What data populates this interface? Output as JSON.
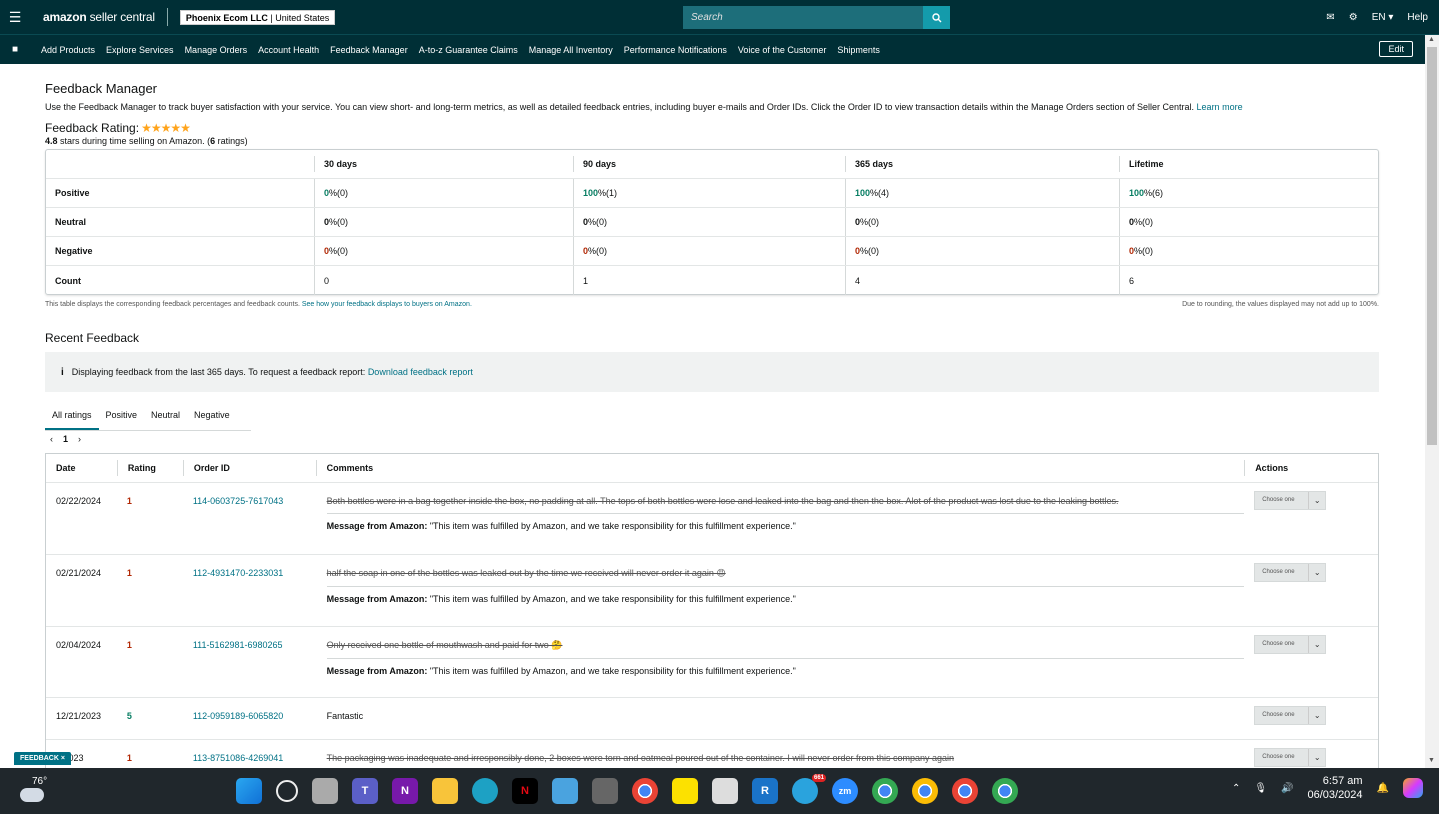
{
  "topbar": {
    "logo_main": "amazon",
    "logo_sub": "seller central",
    "account_name": "Phoenix Ecom LLC",
    "account_country": "United States",
    "search_placeholder": "Search",
    "language": "EN",
    "help": "Help"
  },
  "nav": {
    "items": [
      "Add Products",
      "Explore Services",
      "Manage Orders",
      "Account Health",
      "Feedback Manager",
      "A-to-z Guarantee Claims",
      "Manage All Inventory",
      "Performance Notifications",
      "Voice of the Customer",
      "Shipments"
    ],
    "edit": "Edit"
  },
  "page": {
    "title": "Feedback Manager",
    "intro": "Use the Feedback Manager to track buyer satisfaction with your service. You can view short- and long-term metrics, as well as detailed feedback entries, including buyer e-mails and Order IDs. Click the Order ID to view transaction details within the Manage Orders section of Seller Central.",
    "learn_more": "Learn more",
    "rating_title": "Feedback Rating:",
    "stars": "★★★★★",
    "rating_value": "4.8",
    "rating_text1": "stars during time selling on Amazon. (",
    "rating_count": "6",
    "rating_text2": "ratings)"
  },
  "metrics": {
    "headers": [
      "30 days",
      "90 days",
      "365 days",
      "Lifetime"
    ],
    "rows": [
      {
        "label": "Positive",
        "cells": [
          {
            "v": "0",
            "r": " %(0)"
          },
          {
            "v": "100",
            "r": " %(1)"
          },
          {
            "v": "100",
            "r": " %(4)"
          },
          {
            "v": "100",
            "r": " %(6)"
          }
        ]
      },
      {
        "label": "Neutral",
        "cells": [
          {
            "v": "0",
            "r": " %(0)"
          },
          {
            "v": "0",
            "r": " %(0)"
          },
          {
            "v": "0",
            "r": " %(0)"
          },
          {
            "v": "0",
            "r": " %(0)"
          }
        ]
      },
      {
        "label": "Negative",
        "cells": [
          {
            "v": "0",
            "r": " %(0)"
          },
          {
            "v": "0",
            "r": " %(0)"
          },
          {
            "v": "0",
            "r": " %(0)"
          },
          {
            "v": "0",
            "r": " %(0)"
          }
        ]
      },
      {
        "label": "Count",
        "cells": [
          {
            "v": "",
            "r": "0"
          },
          {
            "v": "",
            "r": "1"
          },
          {
            "v": "",
            "r": "4"
          },
          {
            "v": "",
            "r": "6"
          }
        ]
      }
    ],
    "foot_left": "This table displays the corresponding feedback percentages and feedback counts.",
    "foot_link": "See how your feedback displays to buyers on Amazon.",
    "foot_right": "Due to rounding, the values displayed may not add up to 100%."
  },
  "recent": {
    "title": "Recent Feedback",
    "info_text": "Displaying feedback from the last 365 days. To request a feedback report:",
    "info_link": "Download feedback report",
    "tabs": [
      "All ratings",
      "Positive",
      "Neutral",
      "Negative"
    ],
    "page": "1",
    "headers": [
      "Date",
      "Rating",
      "Order ID",
      "Comments",
      "Actions"
    ],
    "msg_label": "Message from Amazon:",
    "msg_text": " \"This item was fulfilled by Amazon, and we take responsibility for this fulfillment experience.\"",
    "choose": "Choose one",
    "rows": [
      {
        "date": "02/22/2024",
        "rating": "1",
        "order": "114-0603725-7617043",
        "comment": "Both bottles were in a bag together inside the box, no padding at all. The tops of both bottles were lose and leaked into the bag and then the box. Alot of the product was lost due to the leaking bottles.",
        "struck": true
      },
      {
        "date": "02/21/2024",
        "rating": "1",
        "order": "112-4931470-2233031",
        "comment": "half the soap in one of the bottles was leaked out by the time we received will never order it again 😡",
        "struck": true
      },
      {
        "date": "02/04/2024",
        "rating": "1",
        "order": "111-5162981-6980265",
        "comment": "Only received one bottle of mouthwash and paid for two 🤔",
        "struck": true
      },
      {
        "date": "12/21/2023",
        "rating": "5",
        "order": "112-0959189-6065820",
        "comment": "Fantastic",
        "struck": false
      },
      {
        "date": "5/2023",
        "rating": "1",
        "order": "113-8751086-4269041",
        "comment": "The packaging was inadequate and irresponsibly done, 2 boxes were torn and oatmeal poured out of the container. I will never order from this company again",
        "struck": true
      }
    ]
  },
  "feedback_tab": "FEEDBACK ×",
  "taskbar": {
    "temp": "76°",
    "time": "6:57 am",
    "date": "06/03/2024",
    "telegram_badge": "661",
    "zoom": "zm"
  },
  "colors": {
    "header": "#002f36",
    "link": "#007185",
    "positive": "#067d62",
    "negative": "#b12704"
  }
}
